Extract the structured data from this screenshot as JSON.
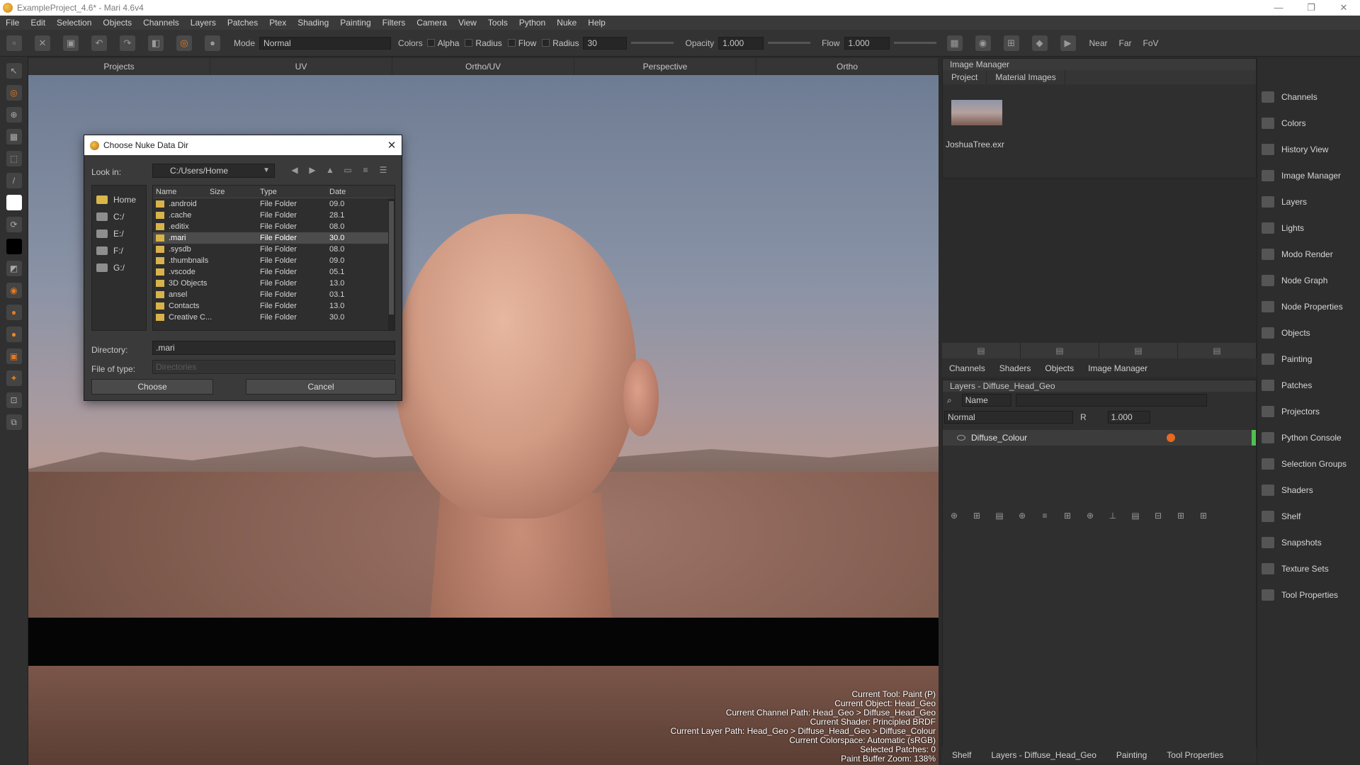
{
  "window": {
    "title": "ExampleProject_4.6* - Mari 4.6v4",
    "controls": [
      "—",
      "❐",
      "✕"
    ]
  },
  "menu": [
    "File",
    "Edit",
    "Selection",
    "Objects",
    "Channels",
    "Layers",
    "Patches",
    "Ptex",
    "Shading",
    "Painting",
    "Filters",
    "Camera",
    "View",
    "Tools",
    "Python",
    "Nuke",
    "Help"
  ],
  "toolbar": {
    "mode_label": "Mode",
    "mode_value": "Normal",
    "colors_label": "Colors",
    "alpha_label": "Alpha",
    "radius_check_label": "Radius",
    "flow_check_label": "Flow",
    "radius_label": "Radius",
    "radius_value": "30",
    "opacity_label": "Opacity",
    "opacity_value": "1.000",
    "flow_label": "Flow",
    "flow_value": "1.000",
    "near_label": "Near",
    "far_label": "Far",
    "fov_label": "FoV"
  },
  "viewport_tabs": [
    "Projects",
    "UV",
    "Ortho/UV",
    "Perspective",
    "Ortho"
  ],
  "status": [
    "Current Tool: Paint (P)",
    "Current Object: Head_Geo",
    "Current Channel Path: Head_Geo > Diffuse_Head_Geo",
    "Current Shader: Principled BRDF",
    "Current Layer Path: Head_Geo > Diffuse_Head_Geo > Diffuse_Colour",
    "Current Colorspace: Automatic (sRGB)",
    "Selected Patches: 0",
    "Paint Buffer Zoom: 138%"
  ],
  "dialog": {
    "title": "Choose Nuke Data Dir",
    "look_in_label": "Look in:",
    "look_in_value": "C:/Users/Home",
    "places": [
      "Home",
      "C:/",
      "E:/",
      "F:/",
      "G:/"
    ],
    "columns": {
      "name": "Name",
      "size": "Size",
      "type": "Type",
      "date": "Date"
    },
    "files": [
      {
        "name": ".android",
        "type": "File Folder",
        "date": "09.0"
      },
      {
        "name": ".cache",
        "type": "File Folder",
        "date": "28.1"
      },
      {
        "name": ".editix",
        "type": "File Folder",
        "date": "08.0"
      },
      {
        "name": ".mari",
        "type": "File Folder",
        "date": "30.0"
      },
      {
        "name": ".sysdb",
        "type": "File Folder",
        "date": "08.0"
      },
      {
        "name": ".thumbnails",
        "type": "File Folder",
        "date": "09.0"
      },
      {
        "name": ".vscode",
        "type": "File Folder",
        "date": "05.1"
      },
      {
        "name": "3D Objects",
        "type": "File Folder",
        "date": "13.0"
      },
      {
        "name": "ansel",
        "type": "File Folder",
        "date": "03.1"
      },
      {
        "name": "Contacts",
        "type": "File Folder",
        "date": "13.0"
      },
      {
        "name": "Creative C...",
        "type": "File Folder",
        "date": "30.0"
      }
    ],
    "selected_index": 3,
    "directory_label": "Directory:",
    "directory_value": ".mari",
    "file_type_label": "File of type:",
    "file_type_value": "Directories",
    "choose_label": "Choose",
    "cancel_label": "Cancel"
  },
  "image_manager": {
    "title": "Image Manager",
    "tabs": [
      "Project",
      "Material Images"
    ],
    "image_name": "JoshuaTree.exr"
  },
  "mid_tabs": [
    "Channels",
    "Shaders",
    "Objects",
    "Image Manager"
  ],
  "layers_panel": {
    "title": "Layers - Diffuse_Head_Geo",
    "filter_label": "Name",
    "blend_mode": "Normal",
    "r_label": "R",
    "opacity_value": "1.000",
    "layer_name": "Diffuse_Colour"
  },
  "bottom_tabs": [
    "Shelf",
    "Layers - Diffuse_Head_Geo",
    "Painting",
    "Tool Properties"
  ],
  "palettes": [
    "Channels",
    "Colors",
    "History View",
    "Image Manager",
    "Layers",
    "Lights",
    "Modo Render",
    "Node Graph",
    "Node Properties",
    "Objects",
    "Painting",
    "Patches",
    "Projectors",
    "Python Console",
    "Selection Groups",
    "Shaders",
    "Shelf",
    "Snapshots",
    "Texture Sets",
    "Tool Properties"
  ]
}
